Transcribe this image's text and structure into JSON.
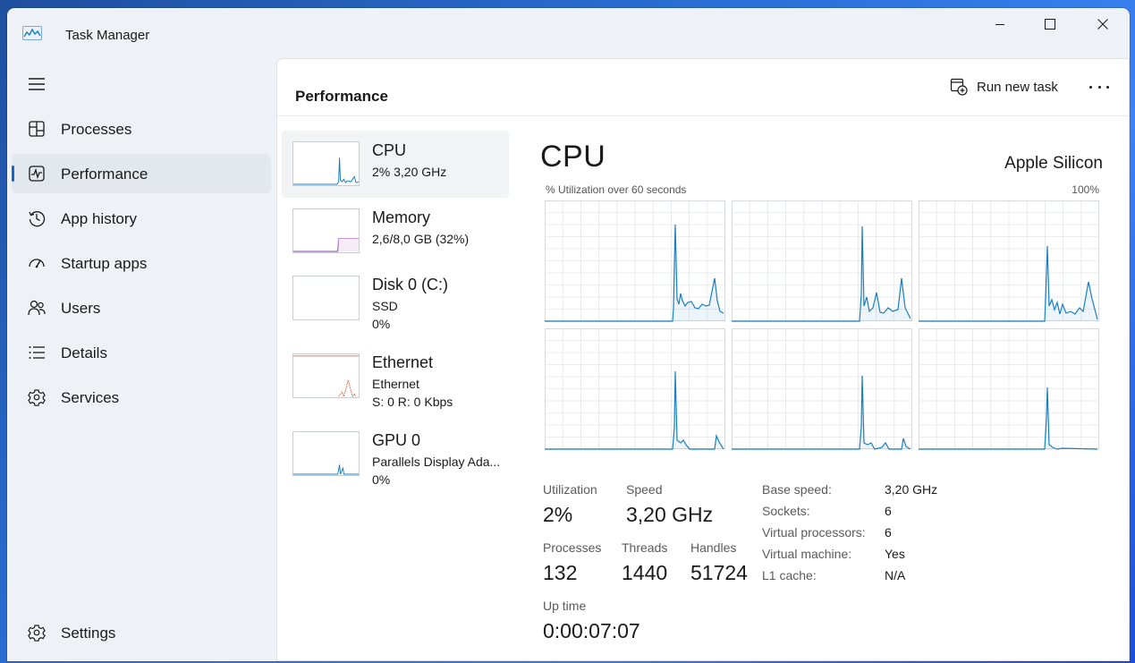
{
  "titlebar": {
    "title": "Task Manager"
  },
  "nav": {
    "items": [
      {
        "label": "Processes",
        "icon": "processes-icon"
      },
      {
        "label": "Performance",
        "icon": "performance-icon",
        "active": true
      },
      {
        "label": "App history",
        "icon": "app-history-icon"
      },
      {
        "label": "Startup apps",
        "icon": "startup-apps-icon"
      },
      {
        "label": "Users",
        "icon": "users-icon"
      },
      {
        "label": "Details",
        "icon": "details-icon"
      },
      {
        "label": "Services",
        "icon": "services-icon"
      }
    ],
    "settings_label": "Settings"
  },
  "header": {
    "title": "Performance",
    "run_new_task": "Run new task"
  },
  "resources": [
    {
      "name": "CPU",
      "line1": "2%  3,20 GHz",
      "line2": ""
    },
    {
      "name": "Memory",
      "line1": "2,6/8,0 GB (32%)",
      "line2": ""
    },
    {
      "name": "Disk 0 (C:)",
      "line1": "SSD",
      "line2": "0%"
    },
    {
      "name": "Ethernet",
      "line1": "Ethernet",
      "line2": "S: 0 R: 0 Kbps"
    },
    {
      "name": "GPU 0",
      "line1": "Parallels Display Ada...",
      "line2": "0%"
    }
  ],
  "detail": {
    "title": "CPU",
    "model": "Apple Silicon",
    "graph_label": "% Utilization over 60 seconds",
    "graph_max": "100%",
    "colors": {
      "cpu_line": "#1a7fc1",
      "grid": "#e3e6e9",
      "memory_line": "#8b3fa8",
      "ethernet_line": "#c9522a"
    },
    "stats": {
      "utilization_label": "Utilization",
      "utilization": "2%",
      "speed_label": "Speed",
      "speed": "3,20 GHz",
      "processes_label": "Processes",
      "processes": "132",
      "threads_label": "Threads",
      "threads": "1440",
      "handles_label": "Handles",
      "handles": "51724",
      "uptime_label": "Up time",
      "uptime": "0:00:07:07"
    },
    "specs": [
      {
        "label": "Base speed:",
        "value": "3,20 GHz"
      },
      {
        "label": "Sockets:",
        "value": "6"
      },
      {
        "label": "Virtual processors:",
        "value": "6"
      },
      {
        "label": "Virtual machine:",
        "value": "Yes"
      },
      {
        "label": "L1 cache:",
        "value": "N/A"
      }
    ]
  }
}
